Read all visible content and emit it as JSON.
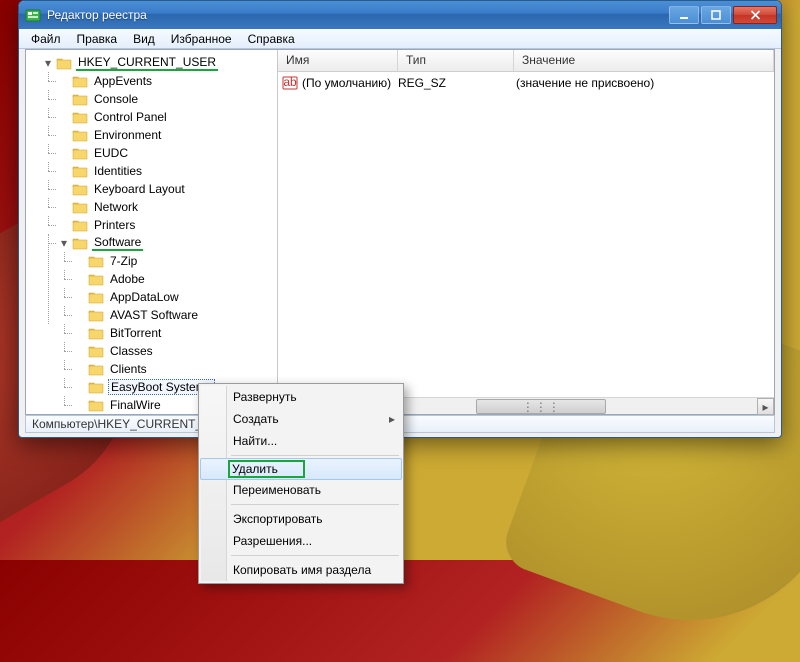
{
  "window": {
    "title": "Редактор реестра"
  },
  "menu": {
    "items": [
      "Файл",
      "Правка",
      "Вид",
      "Избранное",
      "Справка"
    ]
  },
  "columns": {
    "name": "Имя",
    "type": "Тип",
    "value": "Значение"
  },
  "default_row": {
    "name": "(По умолчанию)",
    "type": "REG_SZ",
    "value": "(значение не присвоено)"
  },
  "statusbar": "Компьютер\\HKEY_CURRENT_U",
  "tree": {
    "root": "HKEY_CURRENT_USER",
    "children": [
      {
        "label": "AppEvents"
      },
      {
        "label": "Console"
      },
      {
        "label": "Control Panel"
      },
      {
        "label": "Environment"
      },
      {
        "label": "EUDC"
      },
      {
        "label": "Identities"
      },
      {
        "label": "Keyboard Layout"
      },
      {
        "label": "Network"
      },
      {
        "label": "Printers"
      },
      {
        "label": "Software",
        "expanded": true,
        "highlight": true,
        "children": [
          {
            "label": "7-Zip"
          },
          {
            "label": "Adobe"
          },
          {
            "label": "AppDataLow"
          },
          {
            "label": "AVAST Software"
          },
          {
            "label": "BitTorrent"
          },
          {
            "label": "Classes"
          },
          {
            "label": "Clients"
          },
          {
            "label": "EasyBoot Systems",
            "selected": true
          },
          {
            "label": "FinalWire"
          }
        ]
      }
    ]
  },
  "context_menu": {
    "items": [
      {
        "label": "Развернуть"
      },
      {
        "label": "Создать",
        "submenu": true
      },
      {
        "label": "Найти..."
      },
      {
        "sep": true
      },
      {
        "label": "Удалить",
        "hover": true,
        "boxed": true
      },
      {
        "label": "Переименовать"
      },
      {
        "sep": true
      },
      {
        "label": "Экспортировать"
      },
      {
        "label": "Разрешения..."
      },
      {
        "sep": true
      },
      {
        "label": "Копировать имя раздела"
      }
    ]
  }
}
